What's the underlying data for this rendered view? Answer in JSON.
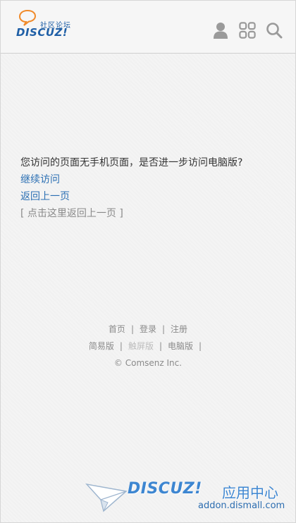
{
  "header": {
    "logo_cn": "社区论坛",
    "logo_en": "DISCUZ!",
    "icons": [
      "user-icon",
      "apps-grid-icon",
      "search-icon"
    ]
  },
  "main": {
    "message": "您访问的页面无手机页面，是否进一步访问电脑版?",
    "continue_link": "继续访问",
    "back_link": "返回上一页",
    "click_back_link": "[ 点击这里返回上一页 ]"
  },
  "footer": {
    "nav": {
      "home": "首页",
      "login": "登录",
      "register": "注册"
    },
    "versions": {
      "simple": "简易版",
      "touch": "触屏版",
      "pc": "电脑版"
    },
    "separator": "|",
    "copyright": "© Comsenz Inc."
  },
  "watermark": {
    "brand": "DISCUZ!",
    "cn": "应用中心",
    "url": "addon.dismall.com"
  },
  "colors": {
    "link": "#2b6fb3",
    "brand": "#1f5fa6",
    "icon": "#9a9a9a"
  }
}
